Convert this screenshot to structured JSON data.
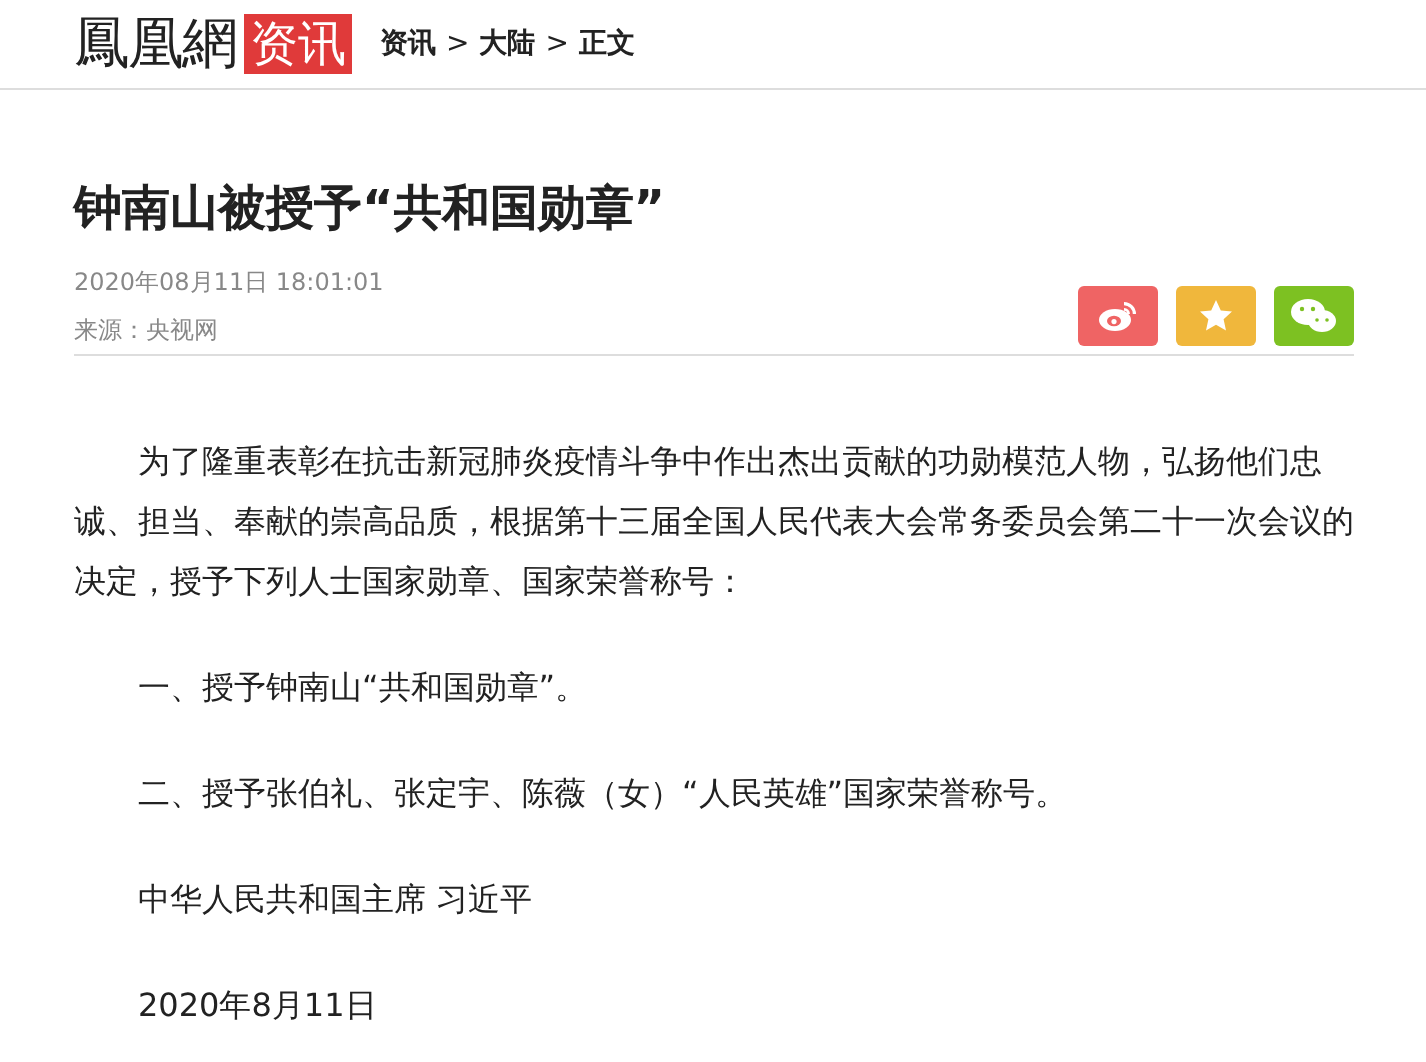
{
  "header": {
    "logo": "鳳凰網",
    "channel": "资讯",
    "breadcrumb": [
      "资讯",
      "大陆",
      "正文"
    ],
    "separator": ">"
  },
  "article": {
    "title": "钟南山被授予“共和国勋章”",
    "date": "2020年08月11日 18:01:01",
    "source": "来源：央视网",
    "share_buttons": [
      {
        "kind": "weibo",
        "color": "#ef6464"
      },
      {
        "kind": "favorite",
        "color": "#f0b73c"
      },
      {
        "kind": "wechat",
        "color": "#7dc122"
      }
    ],
    "paragraphs": [
      "为了隆重表彰在抗击新冠肺炎疫情斗争中作出杰出贡献的功勋模范人物，弘扬他们忠诚、担当、奉献的崇高品质，根据第十三届全国人民代表大会常务委员会第二十一次会议的决定，授予下列人士国家勋章、国家荣誉称号：",
      "一、授予钟南山“共和国勋章”。",
      "二、授予张伯礼、张定宇、陈薇（女）“人民英雄”国家荣誉称号。",
      "中华人民共和国主席 习近平",
      "2020年8月11日"
    ]
  }
}
